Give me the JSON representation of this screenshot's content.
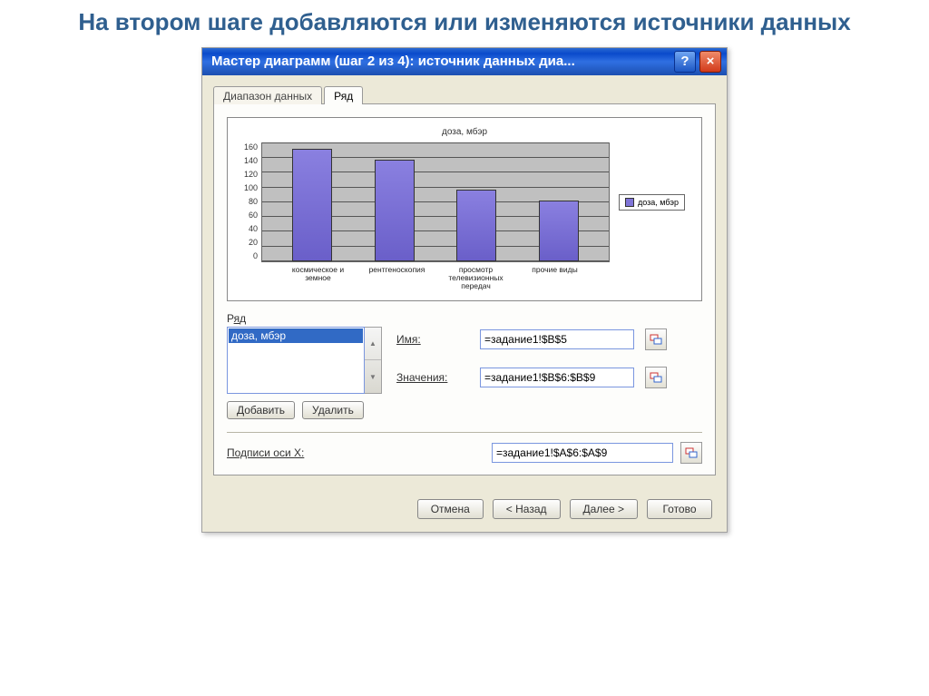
{
  "page_heading": "На втором шаге добавляются или изменяются источники данных",
  "titlebar": {
    "text": "Мастер диаграмм (шаг 2 из 4): источник данных диа...",
    "help_symbol": "?",
    "close_symbol": "×"
  },
  "tabs": {
    "range": "Диапазон данных",
    "series": "Ряд"
  },
  "chart_data": {
    "type": "bar",
    "title": "доза, мбэр",
    "legend": "доза, мбэр",
    "ylim": [
      0,
      160
    ],
    "yticks": [
      0,
      20,
      40,
      60,
      80,
      100,
      120,
      140,
      160
    ],
    "categories": [
      "космическое и земное",
      "рентгеноскопия",
      "просмотр телевизионных передач",
      "прочие виды"
    ],
    "values": [
      150,
      135,
      95,
      80
    ]
  },
  "series_panel": {
    "label": "Ряд",
    "items": [
      "доза, мбэр"
    ],
    "add_btn": "Добавить",
    "remove_btn": "Удалить"
  },
  "fields": {
    "name_label": "Имя:",
    "name_value": "=задание1!$B$5",
    "values_label": "Значения:",
    "values_value": "=задание1!$B$6:$B$9",
    "xaxis_label": "Подписи оси X:",
    "xaxis_value": "=задание1!$A$6:$A$9"
  },
  "wizard": {
    "cancel": "Отмена",
    "back": "< Назад",
    "next": "Далее >",
    "finish": "Готово"
  }
}
